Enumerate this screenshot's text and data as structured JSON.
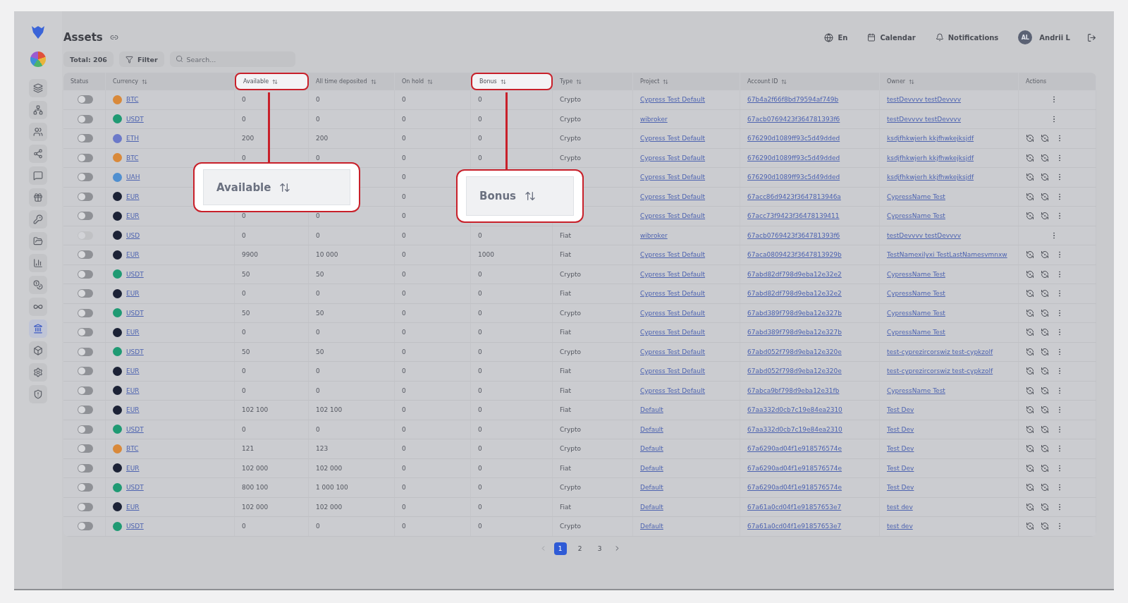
{
  "header": {
    "title": "Assets",
    "language": "En",
    "calendar": "Calendar",
    "notifications": "Notifications",
    "avatar": "AL",
    "user": "Andrii L"
  },
  "sidebar": {
    "items": [
      {
        "selected": false
      },
      {
        "selected": false
      },
      {
        "selected": false
      },
      {
        "selected": false
      },
      {
        "selected": false
      },
      {
        "selected": false
      },
      {
        "selected": false
      },
      {
        "selected": false
      },
      {
        "selected": false
      },
      {
        "selected": false
      },
      {
        "selected": false
      },
      {
        "selected": true
      },
      {
        "selected": false
      },
      {
        "selected": false
      },
      {
        "selected": false
      }
    ]
  },
  "toolbar": {
    "total": "Total: 206",
    "filter": "Filter",
    "search_placeholder": "Search..."
  },
  "table": {
    "columns": [
      {
        "label": "Status",
        "sortable": false,
        "highlighted": false
      },
      {
        "label": "Currency",
        "sortable": true,
        "highlighted": false
      },
      {
        "label": "Available",
        "sortable": true,
        "highlighted": true
      },
      {
        "label": "All time deposited",
        "sortable": true,
        "highlighted": false
      },
      {
        "label": "On hold",
        "sortable": true,
        "highlighted": false
      },
      {
        "label": "Bonus",
        "sortable": true,
        "highlighted": true
      },
      {
        "label": "Type",
        "sortable": true,
        "highlighted": false
      },
      {
        "label": "Project",
        "sortable": true,
        "highlighted": false
      },
      {
        "label": "Account ID",
        "sortable": true,
        "highlighted": false
      },
      {
        "label": "Owner",
        "sortable": true,
        "highlighted": false
      },
      {
        "label": "Actions",
        "sortable": false,
        "highlighted": false
      }
    ],
    "rows": [
      {
        "on": false,
        "disabled": false,
        "currency": "BTC",
        "color": "#d9893a",
        "available": "0",
        "deposited": "0",
        "on_hold": "0",
        "bonus": "0",
        "type": "Crypto",
        "project": "Cypress Test Default",
        "account": "67b4a2f66f8bd79594af749b",
        "owner": "testDevvvv testDevvvv",
        "kind": "menu"
      },
      {
        "on": false,
        "disabled": false,
        "currency": "USDT",
        "color": "#1f9a73",
        "available": "0",
        "deposited": "0",
        "on_hold": "0",
        "bonus": "0",
        "type": "Crypto",
        "project": "wibroker",
        "account": "67acb0769423f364781393f6",
        "owner": "testDevvvv testDevvvv",
        "kind": "menu"
      },
      {
        "on": false,
        "disabled": false,
        "currency": "ETH",
        "color": "#6b79c9",
        "available": "200",
        "deposited": "200",
        "on_hold": "0",
        "bonus": "0",
        "type": "Crypto",
        "project": "Cypress Test Default",
        "account": "676290d1089ff93c5d49dded",
        "owner": "ksdjfhkwjerh kkjfhwkejksjdf",
        "kind": "full"
      },
      {
        "on": false,
        "disabled": false,
        "currency": "BTC",
        "color": "#d9893a",
        "available": "0",
        "deposited": "0",
        "on_hold": "0",
        "bonus": "0",
        "type": "Crypto",
        "project": "Cypress Test Default",
        "account": "676290d1089ff93c5d49dded",
        "owner": "ksdjfhkwjerh kkjfhwkejksjdf",
        "kind": "full"
      },
      {
        "on": false,
        "disabled": false,
        "currency": "UAH",
        "color": "#4f8fd0",
        "on_hold": "0",
        "project": "Cypress Test Default",
        "account": "676290d1089ff93c5d49dded",
        "owner": "ksdjfhkwjerh kkjfhwkejksjdf",
        "kind": "full"
      },
      {
        "on": false,
        "disabled": false,
        "currency": "EUR",
        "color": "#1c2236",
        "on_hold": "0",
        "project": "Cypress Test Default",
        "account": "67acc86d9423f3647813946a",
        "owner": "CypressName Test",
        "kind": "full"
      },
      {
        "on": false,
        "disabled": false,
        "currency": "EUR",
        "color": "#1c2236",
        "available": "0",
        "deposited": "0",
        "on_hold": "0",
        "project": "Cypress Test Default",
        "account": "67acc73f9423f36478139411",
        "owner": "CypressName Test",
        "kind": "full"
      },
      {
        "on": false,
        "disabled": true,
        "currency": "USD",
        "color": "#1c2236",
        "available": "0",
        "deposited": "0",
        "on_hold": "0",
        "bonus": "0",
        "type": "Fiat",
        "project": "wibroker",
        "account": "67acb0769423f364781393f6",
        "owner": "testDevvvv testDevvvv",
        "kind": "menu"
      },
      {
        "on": false,
        "disabled": false,
        "currency": "EUR",
        "color": "#1c2236",
        "available": "9900",
        "deposited": "10 000",
        "on_hold": "0",
        "bonus": "1000",
        "type": "Fiat",
        "project": "Cypress Test Default",
        "account": "67aca0809423f3647813929b",
        "owner": "TestNamexilyxi TestLastNamesvmnxw",
        "kind": "full"
      },
      {
        "on": false,
        "disabled": false,
        "currency": "USDT",
        "color": "#1f9a73",
        "available": "50",
        "deposited": "50",
        "on_hold": "0",
        "bonus": "0",
        "type": "Crypto",
        "project": "Cypress Test Default",
        "account": "67abd82df798d9eba12e32e2",
        "owner": "CypressName Test",
        "kind": "full"
      },
      {
        "on": false,
        "disabled": false,
        "currency": "EUR",
        "color": "#1c2236",
        "available": "0",
        "deposited": "0",
        "on_hold": "0",
        "bonus": "0",
        "type": "Fiat",
        "project": "Cypress Test Default",
        "account": "67abd82df798d9eba12e32e2",
        "owner": "CypressName Test",
        "kind": "full"
      },
      {
        "on": false,
        "disabled": false,
        "currency": "USDT",
        "color": "#1f9a73",
        "available": "50",
        "deposited": "50",
        "on_hold": "0",
        "bonus": "0",
        "type": "Crypto",
        "project": "Cypress Test Default",
        "account": "67abd389f798d9eba12e327b",
        "owner": "CypressName Test",
        "kind": "full"
      },
      {
        "on": false,
        "disabled": false,
        "currency": "EUR",
        "color": "#1c2236",
        "available": "0",
        "deposited": "0",
        "on_hold": "0",
        "bonus": "0",
        "type": "Fiat",
        "project": "Cypress Test Default",
        "account": "67abd389f798d9eba12e327b",
        "owner": "CypressName Test",
        "kind": "full"
      },
      {
        "on": false,
        "disabled": false,
        "currency": "USDT",
        "color": "#1f9a73",
        "available": "50",
        "deposited": "50",
        "on_hold": "0",
        "bonus": "0",
        "type": "Crypto",
        "project": "Cypress Test Default",
        "account": "67abd052f798d9eba12e320e",
        "owner": "test-cyprezircorswiz test-cypkzolf",
        "kind": "full"
      },
      {
        "on": false,
        "disabled": false,
        "currency": "EUR",
        "color": "#1c2236",
        "available": "0",
        "deposited": "0",
        "on_hold": "0",
        "bonus": "0",
        "type": "Fiat",
        "project": "Cypress Test Default",
        "account": "67abd052f798d9eba12e320e",
        "owner": "test-cyprezircorswiz test-cypkzolf",
        "kind": "full"
      },
      {
        "on": false,
        "disabled": false,
        "currency": "EUR",
        "color": "#1c2236",
        "available": "0",
        "deposited": "0",
        "on_hold": "0",
        "bonus": "0",
        "type": "Fiat",
        "project": "Cypress Test Default",
        "account": "67abca9bf798d9eba12e31fb",
        "owner": "CypressName Test",
        "kind": "full"
      },
      {
        "on": false,
        "disabled": false,
        "currency": "EUR",
        "color": "#1c2236",
        "available": "102 100",
        "deposited": "102 100",
        "on_hold": "0",
        "bonus": "0",
        "type": "Fiat",
        "project": "Default",
        "account": "67aa332d0cb7c19e84ea2310",
        "owner": "Test Dev",
        "kind": "full"
      },
      {
        "on": false,
        "disabled": false,
        "currency": "USDT",
        "color": "#1f9a73",
        "available": "0",
        "deposited": "0",
        "on_hold": "0",
        "bonus": "0",
        "type": "Crypto",
        "project": "Default",
        "account": "67aa332d0cb7c19e84ea2310",
        "owner": "Test Dev",
        "kind": "full"
      },
      {
        "on": false,
        "disabled": false,
        "currency": "BTC",
        "color": "#d9893a",
        "available": "121",
        "deposited": "123",
        "on_hold": "0",
        "bonus": "0",
        "type": "Crypto",
        "project": "Default",
        "account": "67a6290ad04f1e918576574e",
        "owner": "Test Dev",
        "kind": "full"
      },
      {
        "on": false,
        "disabled": false,
        "currency": "EUR",
        "color": "#1c2236",
        "available": "102 000",
        "deposited": "102 000",
        "on_hold": "0",
        "bonus": "0",
        "type": "Fiat",
        "project": "Default",
        "account": "67a6290ad04f1e918576574e",
        "owner": "Test Dev",
        "kind": "full"
      },
      {
        "on": false,
        "disabled": false,
        "currency": "USDT",
        "color": "#1f9a73",
        "available": "800 100",
        "deposited": "1 000 100",
        "on_hold": "0",
        "bonus": "0",
        "type": "Crypto",
        "project": "Default",
        "account": "67a6290ad04f1e918576574e",
        "owner": "Test Dev",
        "kind": "full"
      },
      {
        "on": false,
        "disabled": false,
        "currency": "EUR",
        "color": "#1c2236",
        "available": "102 000",
        "deposited": "102 000",
        "on_hold": "0",
        "bonus": "0",
        "type": "Fiat",
        "project": "Default",
        "account": "67a61a0cd04f1e91857653e7",
        "owner": "test dev",
        "kind": "full"
      },
      {
        "on": false,
        "disabled": false,
        "currency": "USDT",
        "color": "#1f9a73",
        "available": "0",
        "deposited": "0",
        "on_hold": "0",
        "bonus": "0",
        "type": "Crypto",
        "project": "Default",
        "account": "67a61a0cd04f1e91857653e7",
        "owner": "test dev",
        "kind": "full"
      }
    ]
  },
  "pagination": {
    "pages": [
      {
        "label": "1",
        "selected": true
      },
      {
        "label": "2",
        "selected": false
      },
      {
        "label": "3",
        "selected": false
      }
    ]
  },
  "callouts": [
    {
      "label": "Available"
    },
    {
      "label": "Bonus"
    }
  ]
}
